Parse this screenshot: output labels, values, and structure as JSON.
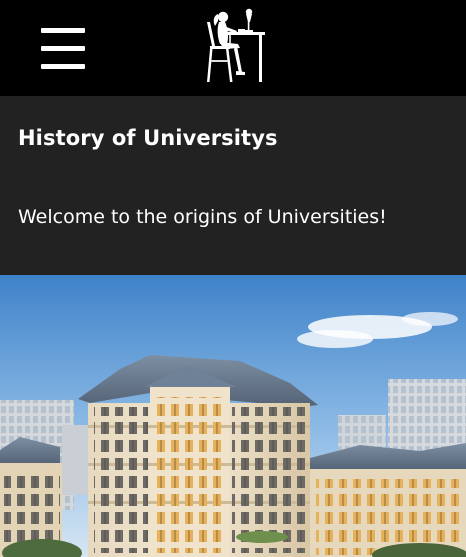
{
  "header": {
    "menu_icon": "hamburger-menu-icon",
    "logo_icon": "woman-studying-at-desk-icon"
  },
  "hero": {
    "title": "History of Universitys",
    "welcome": "Welcome to the origins of Universities!"
  },
  "colors": {
    "topbar": "#000000",
    "hero_panel": "#222222",
    "text": "#ffffff"
  }
}
